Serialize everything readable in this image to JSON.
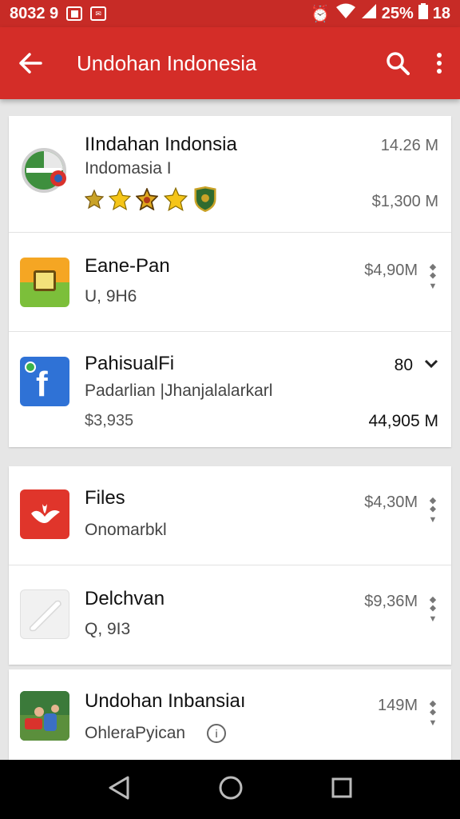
{
  "status_bar": {
    "time": "8032 9",
    "battery_percent": "25%",
    "extra": "18"
  },
  "app_bar": {
    "title": "Undohan Indonesia",
    "back_icon": "arrow-left-icon",
    "search_icon": "search-icon",
    "overflow_icon": "more-vert-icon"
  },
  "items": [
    {
      "name": "IIndahan Indonsia",
      "subtitle": "Indomasia I",
      "size": "14.26 M",
      "price": "$1,300 M",
      "rating_icons": [
        "badge-icon",
        "star-icon",
        "badge-icon",
        "star-icon",
        "shield-icon"
      ]
    },
    {
      "name": "Eane-Pan",
      "subtitle": "U, 9H6",
      "size": "$4,90M"
    },
    {
      "name": "PahisualFi",
      "subtitle": "Padarlian |Jhanjalalarkarl",
      "count": "80",
      "price_left": "$3,935",
      "price_right": "44,905 M"
    },
    {
      "name": "Files",
      "subtitle": "Onomarbkl",
      "size": "$4,30M"
    },
    {
      "name": "Delchvan",
      "subtitle": "Q, 9I3",
      "size": "$9,36M"
    },
    {
      "name": "Undohan Inbansiaı",
      "subtitle": "OhleraPyican",
      "size": "149M"
    }
  ],
  "colors": {
    "app_bar": "#d42d28",
    "status_bar": "#c72b26",
    "background": "#e6e6e6"
  }
}
